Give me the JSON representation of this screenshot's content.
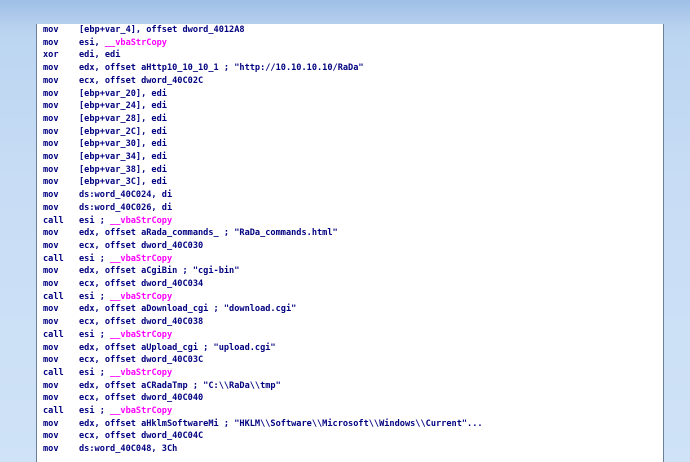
{
  "colors": {
    "background": "#c8ddf5",
    "listing_bg": "#ffffff",
    "code": "#000080",
    "function_ref": "#ff00ff",
    "comment": "#808080"
  },
  "lines": [
    {
      "mnemonic": "mov",
      "parts": [
        {
          "t": "[ebp+var_4], offset dword_4012A8",
          "c": "code"
        }
      ]
    },
    {
      "mnemonic": "mov",
      "parts": [
        {
          "t": "esi, ",
          "c": "code"
        },
        {
          "t": "__vbaStrCopy",
          "c": "fn"
        }
      ]
    },
    {
      "mnemonic": "xor",
      "parts": [
        {
          "t": "edi, edi",
          "c": "code"
        }
      ]
    },
    {
      "mnemonic": "mov",
      "parts": [
        {
          "t": "edx, offset aHttp10_10_10_1 ; \"http://10.10.10.10/RaDa\"",
          "c": "code"
        }
      ]
    },
    {
      "mnemonic": "mov",
      "parts": [
        {
          "t": "ecx, offset dword_40C02C",
          "c": "code"
        }
      ]
    },
    {
      "mnemonic": "mov",
      "parts": [
        {
          "t": "[ebp+var_20], edi",
          "c": "code"
        }
      ]
    },
    {
      "mnemonic": "mov",
      "parts": [
        {
          "t": "[ebp+var_24], edi",
          "c": "code"
        }
      ]
    },
    {
      "mnemonic": "mov",
      "parts": [
        {
          "t": "[ebp+var_28], edi",
          "c": "code"
        }
      ]
    },
    {
      "mnemonic": "mov",
      "parts": [
        {
          "t": "[ebp+var_2C], edi",
          "c": "code"
        }
      ]
    },
    {
      "mnemonic": "mov",
      "parts": [
        {
          "t": "[ebp+var_30], edi",
          "c": "code"
        }
      ]
    },
    {
      "mnemonic": "mov",
      "parts": [
        {
          "t": "[ebp+var_34], edi",
          "c": "code"
        }
      ]
    },
    {
      "mnemonic": "mov",
      "parts": [
        {
          "t": "[ebp+var_38], edi",
          "c": "code"
        }
      ]
    },
    {
      "mnemonic": "mov",
      "parts": [
        {
          "t": "[ebp+var_3C], edi",
          "c": "code"
        }
      ]
    },
    {
      "mnemonic": "mov",
      "parts": [
        {
          "t": "ds:word_40C024, di",
          "c": "code"
        }
      ]
    },
    {
      "mnemonic": "mov",
      "parts": [
        {
          "t": "ds:word_40C026, di",
          "c": "code"
        }
      ]
    },
    {
      "mnemonic": "call",
      "parts": [
        {
          "t": "esi ; ",
          "c": "code"
        },
        {
          "t": "__vbaStrCopy",
          "c": "fn"
        }
      ]
    },
    {
      "mnemonic": "mov",
      "parts": [
        {
          "t": "edx, offset aRada_commands_ ; \"RaDa_commands.html\"",
          "c": "code"
        }
      ]
    },
    {
      "mnemonic": "mov",
      "parts": [
        {
          "t": "ecx, offset dword_40C030",
          "c": "code"
        }
      ]
    },
    {
      "mnemonic": "call",
      "parts": [
        {
          "t": "esi ; ",
          "c": "code"
        },
        {
          "t": "__vbaStrCopy",
          "c": "fn"
        }
      ]
    },
    {
      "mnemonic": "mov",
      "parts": [
        {
          "t": "edx, offset aCgiBin ; \"cgi-bin\"",
          "c": "code"
        }
      ]
    },
    {
      "mnemonic": "mov",
      "parts": [
        {
          "t": "ecx, offset dword_40C034",
          "c": "code"
        }
      ]
    },
    {
      "mnemonic": "call",
      "parts": [
        {
          "t": "esi ; ",
          "c": "code"
        },
        {
          "t": "__vbaStrCopy",
          "c": "fn"
        }
      ]
    },
    {
      "mnemonic": "mov",
      "parts": [
        {
          "t": "edx, offset aDownload_cgi ; \"download.cgi\"",
          "c": "code"
        }
      ]
    },
    {
      "mnemonic": "mov",
      "parts": [
        {
          "t": "ecx, offset dword_40C038",
          "c": "code"
        }
      ]
    },
    {
      "mnemonic": "call",
      "parts": [
        {
          "t": "esi ; ",
          "c": "code"
        },
        {
          "t": "__vbaStrCopy",
          "c": "fn"
        }
      ]
    },
    {
      "mnemonic": "mov",
      "parts": [
        {
          "t": "edx, offset aUpload_cgi ; \"upload.cgi\"",
          "c": "code"
        }
      ]
    },
    {
      "mnemonic": "mov",
      "parts": [
        {
          "t": "ecx, offset dword_40C03C",
          "c": "code"
        }
      ]
    },
    {
      "mnemonic": "call",
      "parts": [
        {
          "t": "esi ; ",
          "c": "code"
        },
        {
          "t": "__vbaStrCopy",
          "c": "fn"
        }
      ]
    },
    {
      "mnemonic": "mov",
      "parts": [
        {
          "t": "edx, offset aCRadaTmp ; \"C:\\\\RaDa\\\\tmp\"",
          "c": "code"
        }
      ]
    },
    {
      "mnemonic": "mov",
      "parts": [
        {
          "t": "ecx, offset dword_40C040",
          "c": "code"
        }
      ]
    },
    {
      "mnemonic": "call",
      "parts": [
        {
          "t": "esi ; ",
          "c": "code"
        },
        {
          "t": "__vbaStrCopy",
          "c": "fn"
        }
      ]
    },
    {
      "mnemonic": "mov",
      "parts": [
        {
          "t": "edx, offset aHklmSoftwareMi ; \"HKLM\\\\Software\\\\Microsoft\\\\Windows\\\\Current\"...",
          "c": "code"
        }
      ]
    },
    {
      "mnemonic": "mov",
      "parts": [
        {
          "t": "ecx, offset dword_40C04C",
          "c": "code"
        }
      ]
    },
    {
      "mnemonic": "mov",
      "parts": [
        {
          "t": "ds:word_40C048, 3Ch",
          "c": "code"
        }
      ]
    }
  ]
}
